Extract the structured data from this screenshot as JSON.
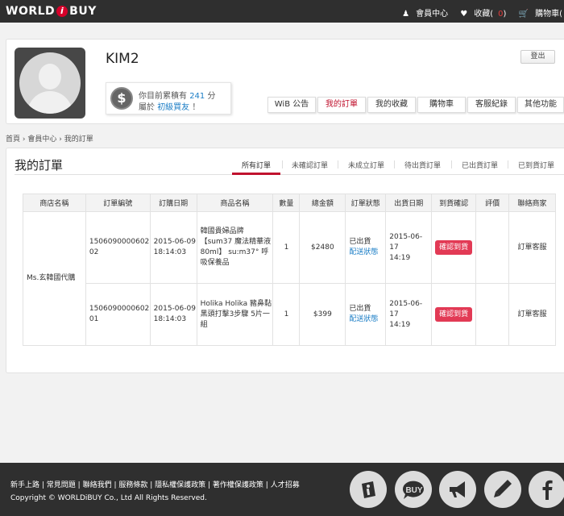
{
  "topbar": {
    "logo_left": "WORLD",
    "logo_badge": "i",
    "logo_right": "BUY",
    "member_center": "會員中心",
    "favorites": "收藏(",
    "favorites_count": "0",
    "favorites_close": ")",
    "cart": "購物車("
  },
  "profile": {
    "username": "KIM2",
    "logout": "登出",
    "points_prefix": "你目前累積有",
    "points_value": "241",
    "points_unit": "分",
    "level_prefix": "屬於",
    "level_name": "初級買友",
    "level_suffix": "！",
    "tabs": [
      {
        "label": "WiB 公告",
        "active": false
      },
      {
        "label": "我的訂單",
        "active": true
      },
      {
        "label": "我的收藏",
        "active": false
      },
      {
        "label": "購物車",
        "active": false
      },
      {
        "label": "客服紀錄",
        "active": false
      },
      {
        "label": "其他功能",
        "active": false
      }
    ]
  },
  "breadcrumb": {
    "home": "首頁",
    "member": "會員中心",
    "current": "我的訂單",
    "sep": "›"
  },
  "orders": {
    "title": "我的訂單",
    "subtabs": [
      {
        "label": "所有訂單",
        "active": true
      },
      {
        "label": "未確認訂單",
        "active": false
      },
      {
        "label": "未成立訂單",
        "active": false
      },
      {
        "label": "待出貨訂單",
        "active": false
      },
      {
        "label": "已出貨訂單",
        "active": false
      },
      {
        "label": "已到貨訂單",
        "active": false
      }
    ],
    "columns": [
      "商店名稱",
      "訂單編號",
      "訂購日期",
      "商品名稱",
      "數量",
      "總金額",
      "訂單狀態",
      "出貨日期",
      "到貨確認",
      "評價",
      "聯絡商家"
    ],
    "store": "Ms.玄韓國代購",
    "rows": [
      {
        "order_no": "150609000060202",
        "date": "2015-06-09",
        "time": "18:14:03",
        "product": "韓國貴婦品牌【sum37 魔法精華液80ml】 su:m37° 呼吸保養品",
        "qty": "1",
        "total": "$2480",
        "status": "已出貨",
        "status_link": "配送狀態",
        "ship_date": "2015-06-17",
        "ship_time": "14:19",
        "confirm": "確認到貨",
        "rating": "",
        "contact": "訂單客服"
      },
      {
        "order_no": "150609000060201",
        "date": "2015-06-09",
        "time": "18:14:03",
        "product": "Holika Holika 豬鼻黏黑頭打擊3步驟 5片一組",
        "qty": "1",
        "total": "$399",
        "status": "已出貨",
        "status_link": "配送狀態",
        "ship_date": "2015-06-17",
        "ship_time": "14:19",
        "confirm": "確認到貨",
        "rating": "",
        "contact": "訂單客服"
      }
    ]
  },
  "footer": {
    "links": [
      "新手上路",
      "常見問題",
      "聯絡我們",
      "服務條款",
      "隱私權保護政策",
      "著作權保護政策",
      "人才招募"
    ],
    "copyright": "Copyright © WORLDiBUY Co., Ltd All Rights Reserved.",
    "buy_label": "BUY",
    "icons": [
      "info-icon",
      "buy-icon",
      "megaphone-icon",
      "pen-icon",
      "facebook-icon"
    ]
  },
  "colors": {
    "accent": "#c0122e",
    "link": "#1c7ec6",
    "confirm": "#e23a55",
    "topbar": "#2f2f2f"
  }
}
